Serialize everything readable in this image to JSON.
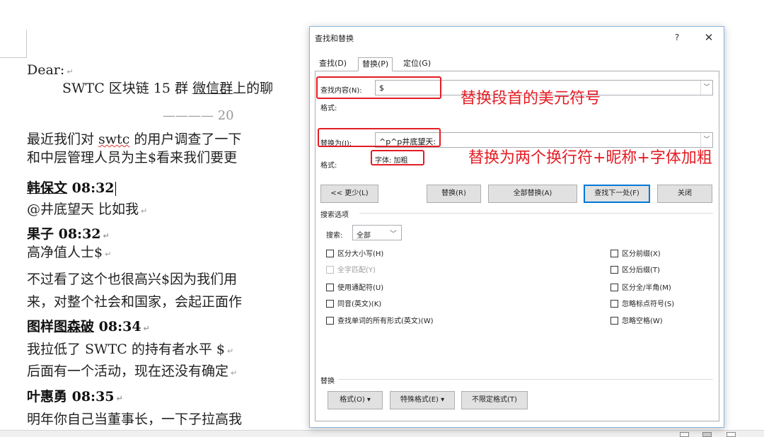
{
  "document": {
    "dear": "Dear:",
    "line2_pre": "SWTC 区块链 15 群 ",
    "line2_link": "微信群",
    "line2_post": "上的聊",
    "date_partial": "———— 20",
    "line3_pre": "最近我们对 ",
    "line3_sq": "swtc",
    "line3_post": " 的用户调查了一下",
    "line4": "和中层管理人员为主$看来我们要更",
    "speaker1": "韩保文",
    "speaker1_time": " 08:32",
    "msg1": "@井底望天 比如我",
    "speaker2": "果子 08:32",
    "msg2": "高净值人士$",
    "msg3": "不过看了这个也很高兴$因为我们用",
    "msg4": "来，对整个社会和国家，会起正面作",
    "speaker3_a": "图样",
    "speaker3_b": "图森破",
    "speaker3_time": " 08:34",
    "msg5": "我拉低了 SWTC 的持有者水平   $",
    "msg6": "后面有一个活动，现在还没有确定",
    "speaker4": "叶惠勇 08:35",
    "msg7": "明年你自己当董事长，一下子拉高我"
  },
  "dialog": {
    "title": "查找和替换",
    "help": "?",
    "close": "✕",
    "tabs": [
      "查找(D)",
      "替换(P)",
      "定位(G)"
    ],
    "find_label": "查找内容(N):",
    "find_value": "$",
    "format_label": "格式:",
    "replace_label": "替换为(I):",
    "replace_value": "^p^p井底望天:",
    "replace_format_label": "格式:",
    "replace_format_value": "字体: 加粗",
    "buttons": {
      "less": "<< 更少(L)",
      "replace": "替换(R)",
      "replace_all": "全部替换(A)",
      "find_next": "查找下一处(F)",
      "close": "关闭"
    },
    "search_options_label": "搜索选项",
    "search_label": "搜索:",
    "search_value": "全部",
    "options_left": [
      "区分大小写(H)",
      "全字匹配(Y)",
      "使用通配符(U)",
      "同音(英文)(K)",
      "查找单词的所有形式(英文)(W)"
    ],
    "options_right": [
      "区分前缀(X)",
      "区分后缀(T)",
      "区分全/半角(M)",
      "忽略标点符号(S)",
      "忽略空格(W)"
    ],
    "replace_section_label": "替换",
    "bottom_buttons": [
      "格式(O) ▾",
      "特殊格式(E) ▾",
      "不限定格式(T)"
    ]
  },
  "annotations": {
    "find_note": "替换段首的美元符号",
    "replace_note": "替换为两个换行符+昵称+字体加粗"
  },
  "colors": {
    "annotation_red": "#e41c24",
    "dialog_border": "#8ab4e0",
    "primary_button_border": "#0078d7"
  }
}
